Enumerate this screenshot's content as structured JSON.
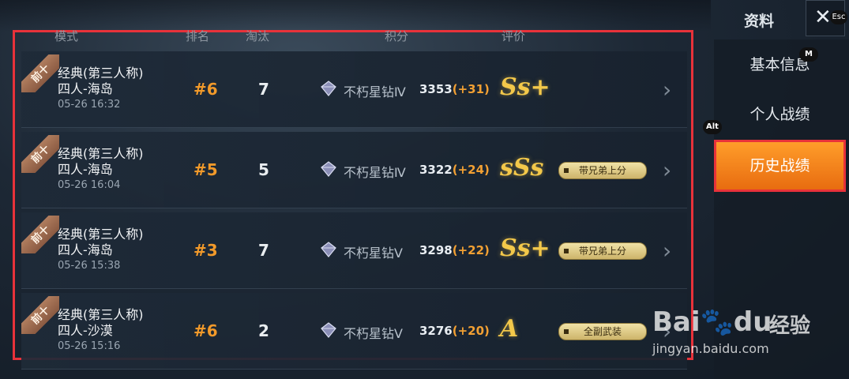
{
  "columns": {
    "mode": "模式",
    "rank": "排名",
    "kills": "淘汰",
    "score": "积分",
    "grade": "评价"
  },
  "rows": [
    {
      "ribbon": "前十",
      "mode": "经典(第三人称)",
      "team": "四人-海岛",
      "date": "05-26 16:32",
      "rank": "#6",
      "kills": "7",
      "tier": "不朽星钻Ⅳ",
      "score": "3353",
      "delta": "(+31)",
      "grade": "Ss+",
      "badge": ""
    },
    {
      "ribbon": "前十",
      "mode": "经典(第三人称)",
      "team": "四人-海岛",
      "date": "05-26 16:04",
      "rank": "#5",
      "kills": "5",
      "tier": "不朽星钻Ⅳ",
      "score": "3322",
      "delta": "(+24)",
      "grade": "sSs",
      "badge": "带兄弟上分"
    },
    {
      "ribbon": "前十",
      "mode": "经典(第三人称)",
      "team": "四人-海岛",
      "date": "05-26 15:38",
      "rank": "#3",
      "kills": "7",
      "tier": "不朽星钻Ⅴ",
      "score": "3298",
      "delta": "(+22)",
      "grade": "Ss+",
      "badge": "带兄弟上分"
    },
    {
      "ribbon": "前十",
      "mode": "经典(第三人称)",
      "team": "四人-沙漠",
      "date": "05-26 15:16",
      "rank": "#6",
      "kills": "2",
      "tier": "不朽星钻Ⅴ",
      "score": "3276",
      "delta": "(+20)",
      "grade": "A",
      "badge": "全副武装"
    }
  ],
  "sidebar": {
    "title": "资料",
    "close_key": "Esc",
    "items": [
      {
        "label": "基本信息",
        "hint": "M"
      },
      {
        "label": "个人战绩",
        "hint": "Alt"
      },
      {
        "label": "历史战绩",
        "hint": ""
      }
    ]
  },
  "watermark": {
    "brand": "Bai",
    "brand2": "du",
    "cn": "经验",
    "url": "jingyan.baidu.com"
  },
  "colors": {
    "accent": "#f29a2a",
    "active_tab": "#f08a1c",
    "highlight_border": "#e8323a"
  },
  "icons": {
    "close": "close-icon",
    "tier": "diamond-tier-icon",
    "chevron": "chevron-right-icon"
  }
}
